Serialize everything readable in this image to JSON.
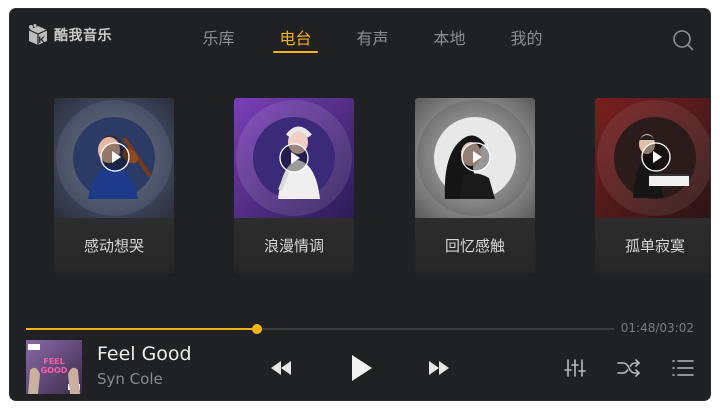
{
  "app": {
    "name": "酷我音乐"
  },
  "nav": {
    "tabs": [
      {
        "label": "乐库",
        "active": false
      },
      {
        "label": "电台",
        "active": true
      },
      {
        "label": "有声",
        "active": false
      },
      {
        "label": "本地",
        "active": false
      },
      {
        "label": "我的",
        "active": false
      }
    ],
    "search_icon": "search-icon"
  },
  "radio_cards": [
    {
      "label": "感动想哭"
    },
    {
      "label": "浪漫情调"
    },
    {
      "label": "回忆感触"
    },
    {
      "label": "孤单寂寞"
    }
  ],
  "player": {
    "title": "Feel Good",
    "artist": "Syn Cole",
    "elapsed_total": "01:48/03:02",
    "progress": 0.393,
    "album_art_text": "FEEL GOOD"
  },
  "colors": {
    "accent": "#f7b217",
    "background": "#202122"
  }
}
